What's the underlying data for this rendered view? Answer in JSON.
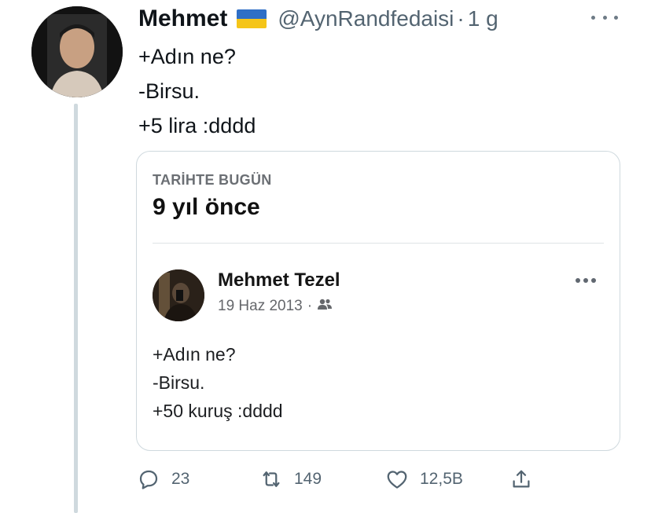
{
  "tweet": {
    "author_name": "Mehmet",
    "handle": "@AynRandfedaisi",
    "separator": "·",
    "time": "1 g",
    "lines": [
      "+Adın ne?",
      "-Birsu.",
      "+5 lira :dddd"
    ]
  },
  "memory_card": {
    "eyebrow": "TARİHTE BUGÜN",
    "title": "9 yıl önce",
    "post": {
      "author": "Mehmet Tezel",
      "date": "19 Haz 2013",
      "separator": "·",
      "privacy_icon": "friends-icon",
      "lines": [
        "+Adın ne?",
        "-Birsu.",
        "+50 kuruş :dddd"
      ]
    }
  },
  "actions": {
    "replies": "23",
    "retweets": "149",
    "likes": "12,5B"
  },
  "colors": {
    "text_primary": "#0f1419",
    "text_secondary": "#536471",
    "border": "#cfd9de",
    "flag_blue": "#2f6fc6",
    "flag_yellow": "#f5c518"
  },
  "icons": [
    "more-horizontal-icon",
    "reply-icon",
    "retweet-icon",
    "like-icon",
    "share-icon",
    "ukraine-flag-icon",
    "friends-icon"
  ]
}
